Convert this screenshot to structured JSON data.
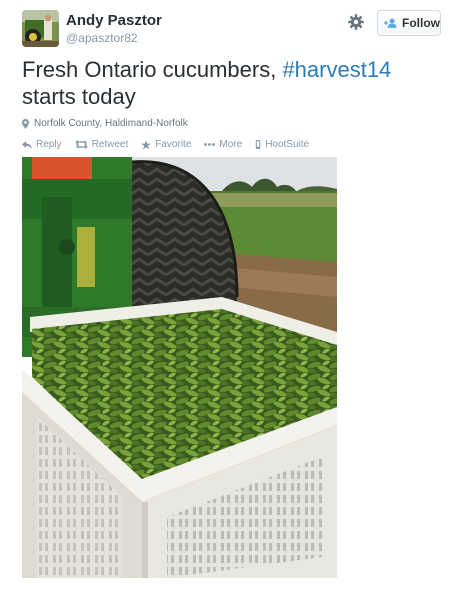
{
  "header": {
    "display_name": "Andy Pasztor",
    "handle": "@apasztor82",
    "follow_label": "Follow",
    "avatar_icon": "avatar-photo",
    "settings_icon": "gear-icon"
  },
  "tweet": {
    "text_part1": "Fresh Ontario cucumbers, ",
    "hashtag": "#harvest14",
    "text_part2": "starts today",
    "location": "Norfolk County, Haldimand-Norfolk"
  },
  "actions": {
    "reply": "Reply",
    "retweet": "Retweet",
    "favorite": "Favorite",
    "more": "More",
    "client": "HootSuite"
  },
  "colors": {
    "link": "#2b7bb9",
    "text": "#292f33",
    "muted": "#8899a6",
    "follow_icon": "#55acee"
  },
  "photo": {
    "subject": "cucumber-harvest-photo"
  }
}
